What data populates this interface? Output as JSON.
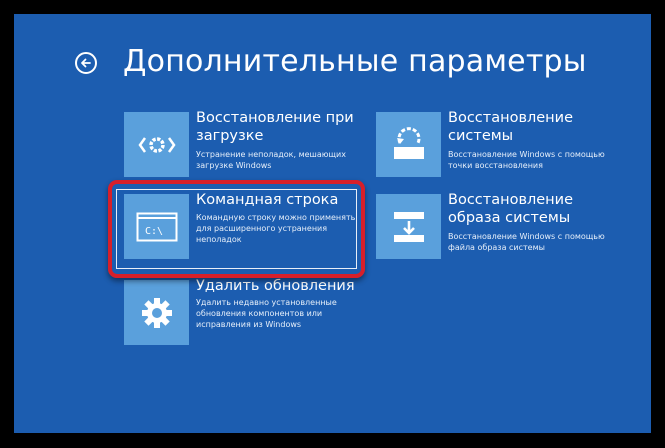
{
  "page": {
    "title": "Дополнительные параметры"
  },
  "options": [
    {
      "title": "Восстановление при загрузке",
      "desc": "Устранение неполадок, мешающих загрузке Windows",
      "icon": "startup-repair-icon"
    },
    {
      "title": "Восстановление системы",
      "desc": "Восстановление Windows с помощью точки восстановления",
      "icon": "system-restore-icon"
    },
    {
      "title": "Командная строка",
      "desc": "Командную строку можно применять для расширенного устранения неполадок",
      "icon": "command-prompt-icon",
      "icon_text": "C:\\"
    },
    {
      "title": "Восстановление образа системы",
      "desc": "Восстановление Windows с помощью файла образа системы",
      "icon": "system-image-icon"
    },
    {
      "title": "Удалить обновления",
      "desc": "Удалить недавно установленные обновления компонентов или исправления из Windows",
      "icon": "gear-icon"
    }
  ],
  "colors": {
    "background": "#1c5db0",
    "tile": "#5aa0dc",
    "highlight": "#d71f2a"
  }
}
